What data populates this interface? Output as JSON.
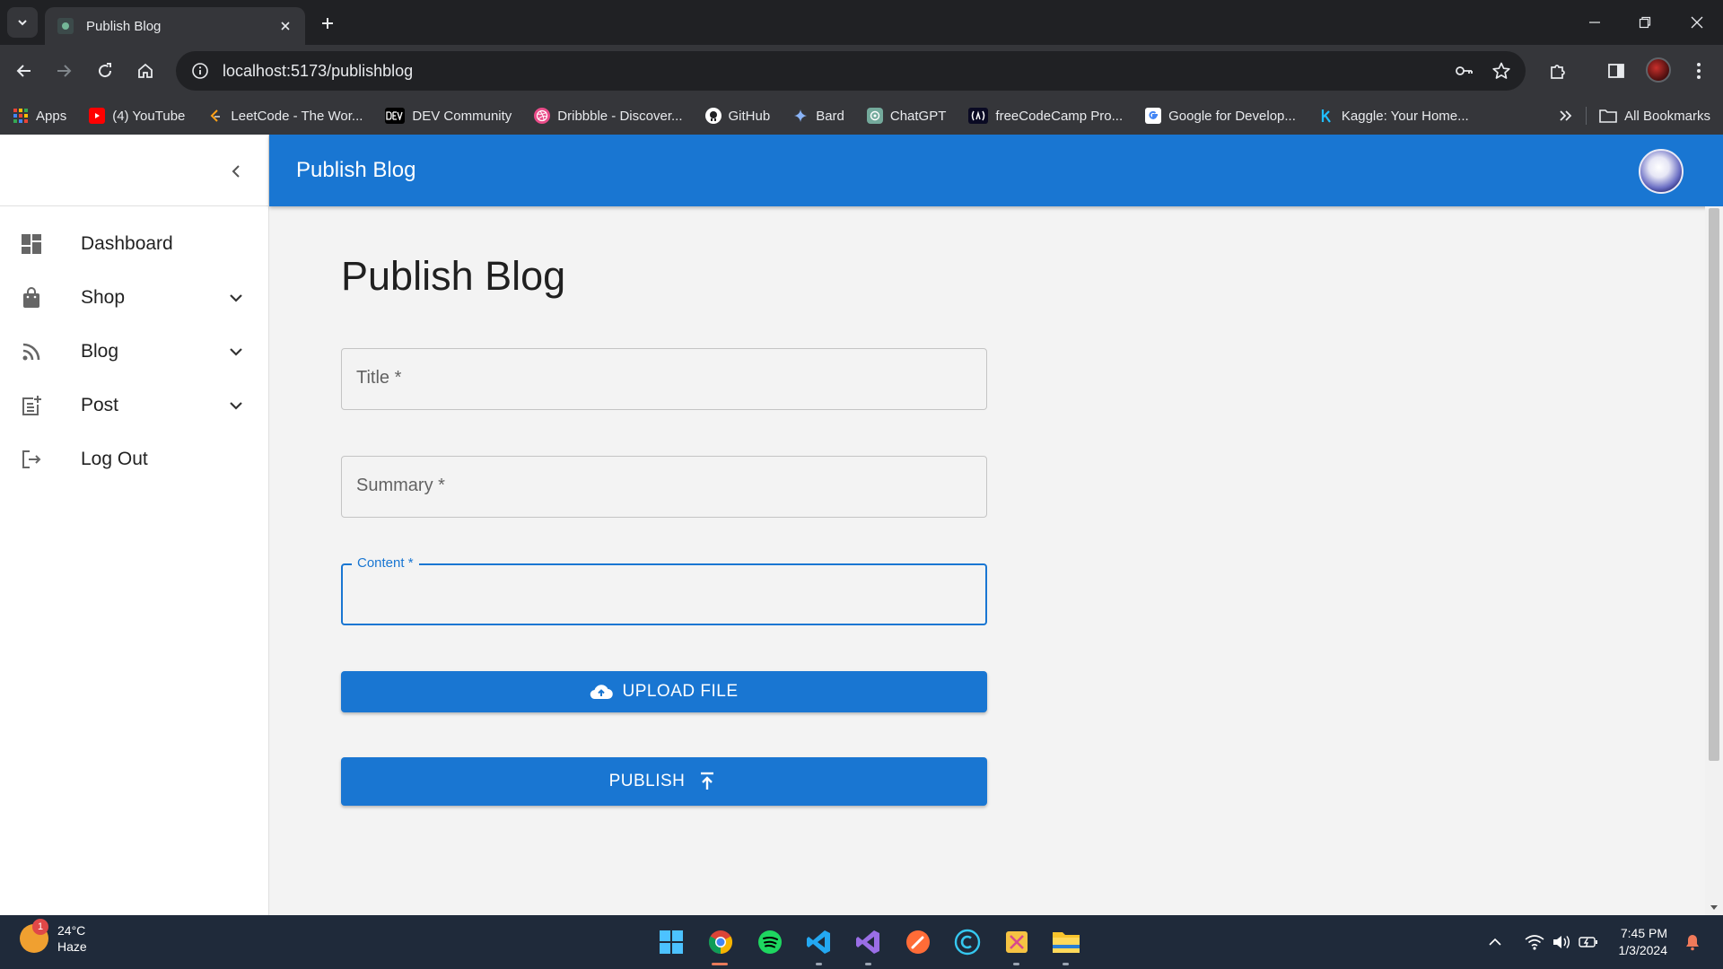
{
  "browser": {
    "tab_title": "Publish Blog",
    "url": "localhost:5173/publishblog",
    "bookmarks": [
      {
        "label": "Apps",
        "icon": "apps-grid-icon",
        "color": "#e8eaed"
      },
      {
        "label": "(4) YouTube",
        "icon": "youtube-icon",
        "color": "#ff0000"
      },
      {
        "label": "LeetCode - The Wor...",
        "icon": "leetcode-icon",
        "color": "#ffa116"
      },
      {
        "label": "DEV Community",
        "icon": "dev-icon",
        "color": "#000000"
      },
      {
        "label": "Dribbble - Discover...",
        "icon": "dribbble-icon",
        "color": "#ea4c89"
      },
      {
        "label": "GitHub",
        "icon": "github-icon",
        "color": "#ffffff"
      },
      {
        "label": "Bard",
        "icon": "bard-icon",
        "color": "#8ab4f8"
      },
      {
        "label": "ChatGPT",
        "icon": "chatgpt-icon",
        "color": "#74aa9c"
      },
      {
        "label": "freeCodeCamp Pro...",
        "icon": "freecodecamp-icon",
        "color": "#0a0a23"
      },
      {
        "label": "Google for Develop...",
        "icon": "google-icon",
        "color": "#ffffff"
      },
      {
        "label": "Kaggle: Your Home...",
        "icon": "kaggle-icon",
        "color": "#20beff"
      }
    ],
    "all_bookmarks": "All Bookmarks"
  },
  "app": {
    "appbar_title": "Publish Blog",
    "accent": "#1976d2",
    "nav": [
      {
        "label": "Dashboard",
        "icon": "dashboard-icon",
        "has_submenu": false
      },
      {
        "label": "Shop",
        "icon": "shopping-bag-icon",
        "has_submenu": true
      },
      {
        "label": "Blog",
        "icon": "rss-feed-icon",
        "has_submenu": true
      },
      {
        "label": "Post",
        "icon": "post-add-icon",
        "has_submenu": true
      },
      {
        "label": "Log Out",
        "icon": "logout-icon",
        "has_submenu": false
      }
    ]
  },
  "form": {
    "heading": "Publish Blog",
    "title_placeholder": "Title *",
    "summary_placeholder": "Summary *",
    "content_label": "Content *",
    "content_value": "",
    "upload_label": "UPLOAD FILE",
    "publish_label": "PUBLISH"
  },
  "taskbar": {
    "temperature": "24°C",
    "condition": "Haze",
    "weather_badge": "1",
    "time": "7:45 PM",
    "date": "1/3/2024"
  }
}
